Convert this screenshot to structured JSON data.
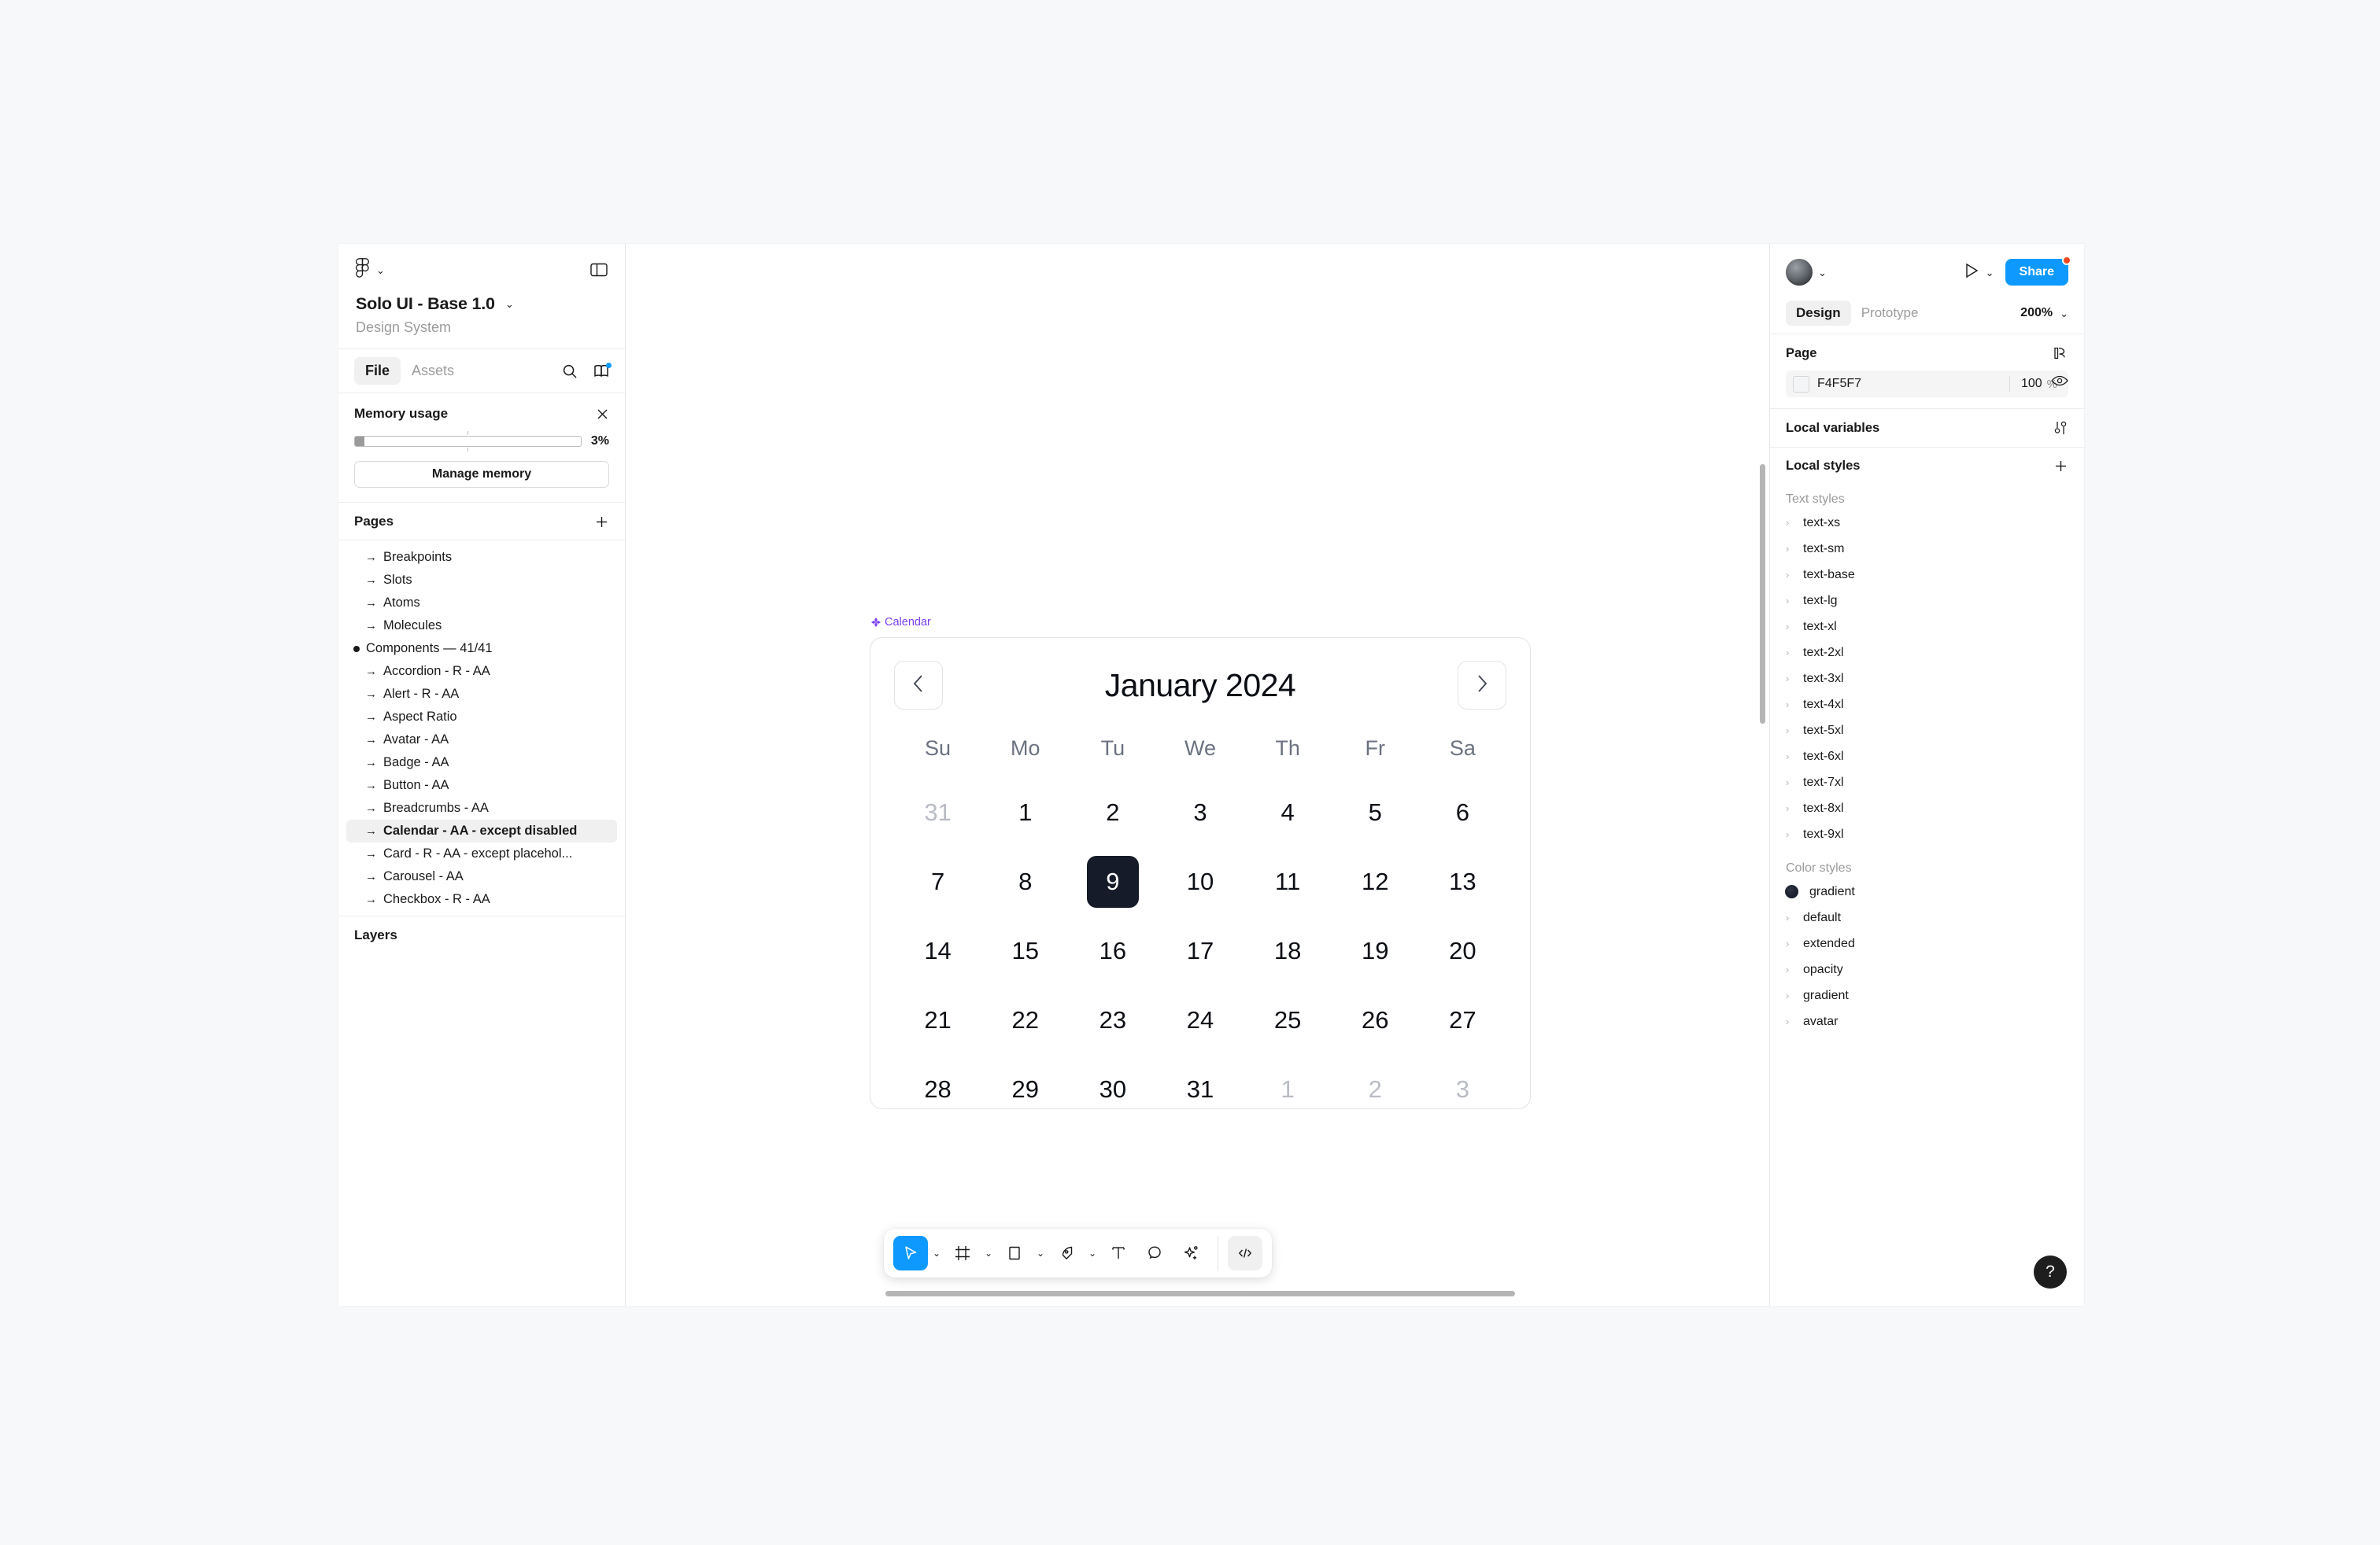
{
  "left_panel": {
    "logo_icon": "figma-logo-icon",
    "logo_caret": "⌄",
    "panel_toggle_icon": "left-panel-toggle-icon",
    "file_name": "Solo UI - Base 1.0",
    "file_name_caret": "⌄",
    "file_subtitle": "Design System",
    "tabs": [
      {
        "label": "File",
        "active": true
      },
      {
        "label": "Assets",
        "active": false
      }
    ],
    "search_icon": "search-icon",
    "library_icon": "library-book-icon",
    "memory": {
      "title": "Memory usage",
      "close_icon": "close-icon",
      "percent": "3%",
      "fill_ratio": 0.03,
      "button_label": "Manage memory"
    },
    "pages": {
      "title": "Pages",
      "add_icon": "plus-icon",
      "items": [
        {
          "label": "Breakpoints",
          "marker": "arrow",
          "indent": true,
          "selected": false
        },
        {
          "label": "Slots",
          "marker": "arrow",
          "indent": true,
          "selected": false
        },
        {
          "label": "Atoms",
          "marker": "arrow",
          "indent": true,
          "selected": false
        },
        {
          "label": "Molecules",
          "marker": "arrow",
          "indent": true,
          "selected": false
        },
        {
          "label": "Components — 41/41",
          "marker": "dot",
          "indent": false,
          "selected": false
        },
        {
          "label": "Accordion - R - AA",
          "marker": "arrow",
          "indent": true,
          "selected": false
        },
        {
          "label": "Alert - R - AA",
          "marker": "arrow",
          "indent": true,
          "selected": false
        },
        {
          "label": "Aspect Ratio",
          "marker": "arrow",
          "indent": true,
          "selected": false
        },
        {
          "label": "Avatar - AA",
          "marker": "arrow",
          "indent": true,
          "selected": false
        },
        {
          "label": "Badge - AA",
          "marker": "arrow",
          "indent": true,
          "selected": false
        },
        {
          "label": "Button - AA",
          "marker": "arrow",
          "indent": true,
          "selected": false
        },
        {
          "label": "Breadcrumbs  - AA",
          "marker": "arrow",
          "indent": true,
          "selected": false
        },
        {
          "label": "Calendar - AA - except disabled",
          "marker": "arrow",
          "indent": true,
          "selected": true
        },
        {
          "label": "Card - R - AA - except placehol...",
          "marker": "arrow",
          "indent": true,
          "selected": false
        },
        {
          "label": "Carousel  - AA",
          "marker": "arrow",
          "indent": true,
          "selected": false
        },
        {
          "label": "Checkbox - R - AA",
          "marker": "arrow",
          "indent": true,
          "selected": false
        }
      ]
    },
    "layers_title": "Layers"
  },
  "canvas": {
    "frame_label": "Calendar",
    "frame_label_icon": "component-diamond-icon",
    "frame_label_color": "#7b3ff2",
    "calendar": {
      "prev_icon": "chevron-left-icon",
      "next_icon": "chevron-right-icon",
      "title": "January 2024",
      "weekdays": [
        "Su",
        "Mo",
        "Tu",
        "We",
        "Th",
        "Fr",
        "Sa"
      ],
      "selected_day": "9",
      "selected_bg": "#151b28",
      "weeks": [
        [
          {
            "d": "31",
            "state": "muted"
          },
          {
            "d": "1",
            "state": "normal"
          },
          {
            "d": "2",
            "state": "normal"
          },
          {
            "d": "3",
            "state": "normal"
          },
          {
            "d": "4",
            "state": "normal"
          },
          {
            "d": "5",
            "state": "normal"
          },
          {
            "d": "6",
            "state": "normal"
          }
        ],
        [
          {
            "d": "7",
            "state": "normal"
          },
          {
            "d": "8",
            "state": "normal"
          },
          {
            "d": "9",
            "state": "selected"
          },
          {
            "d": "10",
            "state": "normal"
          },
          {
            "d": "11",
            "state": "normal"
          },
          {
            "d": "12",
            "state": "normal"
          },
          {
            "d": "13",
            "state": "normal"
          }
        ],
        [
          {
            "d": "14",
            "state": "normal"
          },
          {
            "d": "15",
            "state": "normal"
          },
          {
            "d": "16",
            "state": "normal"
          },
          {
            "d": "17",
            "state": "normal"
          },
          {
            "d": "18",
            "state": "normal"
          },
          {
            "d": "19",
            "state": "normal"
          },
          {
            "d": "20",
            "state": "normal"
          }
        ],
        [
          {
            "d": "21",
            "state": "normal"
          },
          {
            "d": "22",
            "state": "normal"
          },
          {
            "d": "23",
            "state": "normal"
          },
          {
            "d": "24",
            "state": "normal"
          },
          {
            "d": "25",
            "state": "normal"
          },
          {
            "d": "26",
            "state": "normal"
          },
          {
            "d": "27",
            "state": "normal"
          }
        ],
        [
          {
            "d": "28",
            "state": "normal"
          },
          {
            "d": "29",
            "state": "normal"
          },
          {
            "d": "30",
            "state": "normal"
          },
          {
            "d": "31",
            "state": "normal"
          },
          {
            "d": "1",
            "state": "muted"
          },
          {
            "d": "2",
            "state": "muted"
          },
          {
            "d": "3",
            "state": "muted"
          }
        ]
      ]
    },
    "toolbar": {
      "active_color": "#0d99ff",
      "tools": [
        {
          "name": "move-tool",
          "icon": "cursor-icon",
          "active": true,
          "caret": true
        },
        {
          "name": "frame-tool",
          "icon": "frame-icon",
          "active": false,
          "caret": true
        },
        {
          "name": "shape-tool",
          "icon": "square-icon",
          "active": false,
          "caret": true
        },
        {
          "name": "pen-tool",
          "icon": "pen-icon",
          "active": false,
          "caret": true
        },
        {
          "name": "text-tool",
          "icon": "text-t-icon",
          "active": false,
          "caret": false
        },
        {
          "name": "comment-tool",
          "icon": "comment-icon",
          "active": false,
          "caret": false
        },
        {
          "name": "actions-tool",
          "icon": "sparkle-icon",
          "active": false,
          "caret": false
        }
      ],
      "dev_mode": {
        "name": "dev-mode-toggle",
        "icon": "code-brackets-icon"
      }
    }
  },
  "right_panel": {
    "avatar_icon": "user-avatar",
    "avatar_caret": "⌄",
    "present_icon": "play-present-icon",
    "present_caret": "⌄",
    "share_label": "Share",
    "share_badge": true,
    "tabs": [
      {
        "label": "Design",
        "active": true
      },
      {
        "label": "Prototype",
        "active": false
      }
    ],
    "zoom_level": "200%",
    "zoom_caret": "⌄",
    "page_section": {
      "title": "Page",
      "action_icon": "page-settings-icon",
      "color_hex": "F4F5F7",
      "opacity": "100",
      "opacity_unit": "%",
      "visibility_icon": "eye-icon"
    },
    "local_variables": {
      "title": "Local variables",
      "action_icon": "sliders-icon"
    },
    "local_styles": {
      "title": "Local styles",
      "action_icon": "plus-icon",
      "text_styles_label": "Text styles",
      "text_styles": [
        "text-xs",
        "text-sm",
        "text-base",
        "text-lg",
        "text-xl",
        "text-2xl",
        "text-3xl",
        "text-4xl",
        "text-5xl",
        "text-6xl",
        "text-7xl",
        "text-8xl",
        "text-9xl"
      ],
      "color_styles_label": "Color styles",
      "color_styles": [
        {
          "label": "gradient",
          "type": "swatch"
        },
        {
          "label": "default",
          "type": "folder"
        },
        {
          "label": "extended",
          "type": "folder"
        },
        {
          "label": "opacity",
          "type": "folder"
        },
        {
          "label": "gradient",
          "type": "folder"
        },
        {
          "label": "avatar",
          "type": "folder"
        }
      ]
    },
    "help_label": "?"
  }
}
